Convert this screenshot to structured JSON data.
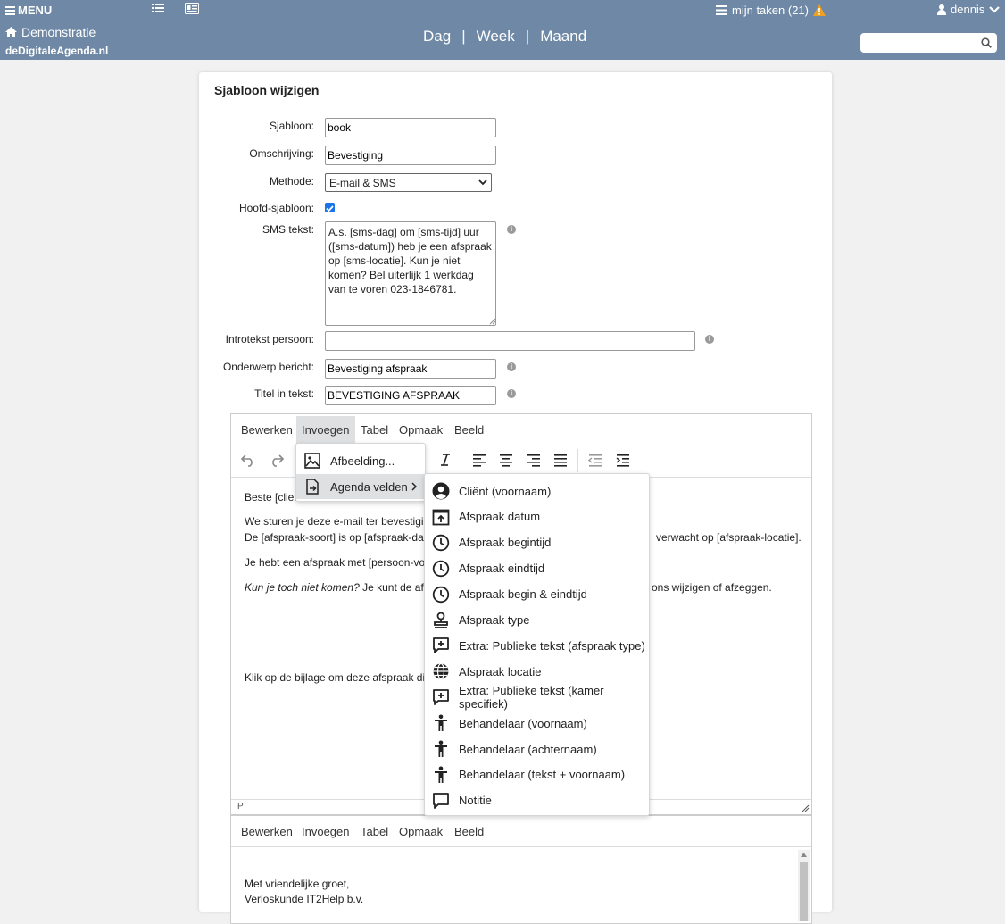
{
  "topbar": {
    "menu_label": "MENU",
    "tasks_label": "mijn taken (21)",
    "user_label": "dennis",
    "org_label": "Demonstratie",
    "brand_label": "deDigitaleAgenda.nl",
    "views": [
      "Dag",
      "Week",
      "Maand"
    ],
    "separator": "|",
    "search_placeholder": ""
  },
  "form": {
    "title": "Sjabloon wijzigen",
    "sjabloon_label": "Sjabloon:",
    "sjabloon_value": "book",
    "omschrijving_label": "Omschrijving:",
    "omschrijving_value": "Bevestiging",
    "methode_label": "Methode:",
    "methode_value": "E-mail & SMS",
    "hoofd_label": "Hoofd-sjabloon:",
    "hoofd_checked": true,
    "sms_label": "SMS tekst:",
    "sms_value": "A.s. [sms-dag] om [sms-tijd] uur ([sms-datum]) heb je een afspraak op [sms-locatie]. Kun je niet komen? Bel uiterlijk 1 werkdag van te voren 023-1846781.",
    "intro_label": "Introtekst persoon:",
    "intro_value": "",
    "onderwerp_label": "Onderwerp bericht:",
    "onderwerp_value": "Bevestiging afspraak",
    "titel_label": "Titel in tekst:",
    "titel_value": "BEVESTIGING AFSPRAAK"
  },
  "editor": {
    "menubar": [
      "Bewerken",
      "Invoegen",
      "Tabel",
      "Opmaak",
      "Beeld"
    ],
    "body": {
      "line1": "Beste [clien",
      "line2": "We sturen je deze e-mail ter bevestigin",
      "line3": "De [afspraak-soort] is op [afspraak-datu",
      "line3_tail": "verwacht op [afspraak-locatie].",
      "line4": "Je hebt een afspraak met [persoon-voo",
      "line5_italic": "Kun je toch niet komen?",
      "line5": " Je kunt de afsp",
      "line5_tail": "ons wijzigen of afzeggen.",
      "line6": "Klik op de bijlage om deze afspraak dir"
    },
    "status": "P"
  },
  "insert_menu": {
    "items": [
      {
        "label": "Afbeelding...",
        "icon": "image-icon"
      },
      {
        "label": "Agenda velden",
        "icon": "insert-field-icon"
      }
    ]
  },
  "agenda_fields": [
    {
      "label": "Cliënt (voornaam)",
      "icon": "account-circle-icon"
    },
    {
      "label": "Afspraak datum",
      "icon": "calendar-upload-icon"
    },
    {
      "label": "Afspraak begintijd",
      "icon": "clock-icon"
    },
    {
      "label": "Afspraak eindtijd",
      "icon": "clock-icon"
    },
    {
      "label": "Afspraak begin & eindtijd",
      "icon": "clock-icon"
    },
    {
      "label": "Afspraak type",
      "icon": "stamp-icon"
    },
    {
      "label": "Extra: Publieke tekst (afspraak type)",
      "icon": "comment-plus-icon"
    },
    {
      "label": "Afspraak locatie",
      "icon": "globe-icon"
    },
    {
      "label": "Extra: Publieke tekst (kamer specifiek)",
      "icon": "comment-plus-icon"
    },
    {
      "label": "Behandelaar (voornaam)",
      "icon": "person-icon"
    },
    {
      "label": "Behandelaar (achternaam)",
      "icon": "person-icon"
    },
    {
      "label": "Behandelaar (tekst + voornaam)",
      "icon": "person-icon"
    },
    {
      "label": "Notitie",
      "icon": "comment-icon"
    }
  ],
  "editor2": {
    "menubar": [
      "Bewerken",
      "Invoegen",
      "Tabel",
      "Opmaak",
      "Beeld"
    ],
    "line1": "Met vriendelijke groet,",
    "line2": "Verloskunde IT2Help b.v."
  }
}
